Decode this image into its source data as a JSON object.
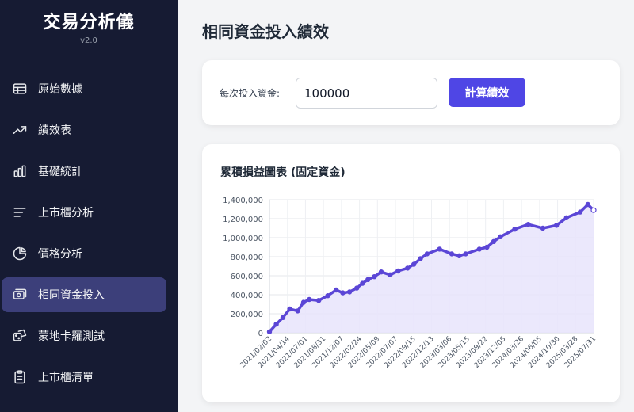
{
  "app": {
    "title": "交易分析儀",
    "version": "v2.0"
  },
  "sidebar": {
    "items": [
      {
        "label": "原始數據",
        "icon": "table-icon",
        "active": false
      },
      {
        "label": "績效表",
        "icon": "trend-up-icon",
        "active": false
      },
      {
        "label": "基礎統計",
        "icon": "bar-chart-icon",
        "active": false
      },
      {
        "label": "上市櫃分析",
        "icon": "list-lines-icon",
        "active": false
      },
      {
        "label": "價格分析",
        "icon": "pie-chart-icon",
        "active": false
      },
      {
        "label": "相同資金投入",
        "icon": "money-icon",
        "active": true
      },
      {
        "label": "蒙地卡羅測試",
        "icon": "dice-icon",
        "active": false
      },
      {
        "label": "上市櫃清單",
        "icon": "clipboard-icon",
        "active": false
      }
    ]
  },
  "main": {
    "title": "相同資金投入績效",
    "amount_label": "每次投入資金:",
    "amount_value": "100000",
    "calc_button": "計算績效",
    "chart_title": "累積損益圖表 (固定資金)"
  },
  "colors": {
    "accent": "#4f46e5",
    "sidebar_bg": "#161b33",
    "line": "#5b46d6",
    "fill": "#e7e4fb"
  },
  "chart_data": {
    "type": "area",
    "title": "累積損益圖表 (固定資金)",
    "xlabel": "",
    "ylabel": "",
    "ylim": [
      0,
      1400000
    ],
    "yticks": [
      "0",
      "200,000",
      "400,000",
      "600,000",
      "800,000",
      "1,000,000",
      "1,200,000",
      "1,400,000"
    ],
    "xticks": [
      "2021/02/02",
      "2021/04/14",
      "2021/07/01",
      "2021/08/31",
      "2021/12/07",
      "2022/02/24",
      "2022/05/09",
      "2022/07/07",
      "2022/09/15",
      "2022/12/13",
      "2023/03/06",
      "2023/05/15",
      "2023/09/22",
      "2023/12/05",
      "2024/03/26",
      "2024/06/05",
      "2024/10/30",
      "2025/03/28",
      "2025/07/31"
    ],
    "grid": true,
    "legend": "none",
    "series": [
      {
        "x": [
          "2021/02/02",
          "2021/03/10",
          "2021/04/14",
          "2021/05/20",
          "2021/07/01",
          "2021/08/01",
          "2021/08/31",
          "2021/10/20",
          "2021/12/07",
          "2022/01/20",
          "2022/02/24",
          "2022/04/01",
          "2022/05/09",
          "2022/06/08",
          "2022/07/07",
          "2022/08/10",
          "2022/09/15",
          "2022/11/01",
          "2022/12/13",
          "2023/02/01",
          "2023/03/06",
          "2023/04/10",
          "2023/05/15",
          "2023/07/20",
          "2023/09/22",
          "2023/11/01",
          "2023/12/05",
          "2024/02/15",
          "2024/03/26",
          "2024/05/01",
          "2024/06/05",
          "2024/08/20",
          "2024/10/30",
          "2025/01/15",
          "2025/03/28",
          "2025/05/20",
          "2025/07/31",
          "2025/09/10",
          "2025/10/10"
        ],
        "values": [
          10000,
          90000,
          160000,
          250000,
          230000,
          320000,
          350000,
          340000,
          390000,
          450000,
          420000,
          430000,
          470000,
          520000,
          560000,
          590000,
          640000,
          610000,
          650000,
          680000,
          720000,
          780000,
          830000,
          880000,
          830000,
          810000,
          830000,
          880000,
          900000,
          960000,
          1010000,
          1090000,
          1140000,
          1100000,
          1130000,
          1210000,
          1270000,
          1350000,
          1290000
        ]
      }
    ]
  }
}
